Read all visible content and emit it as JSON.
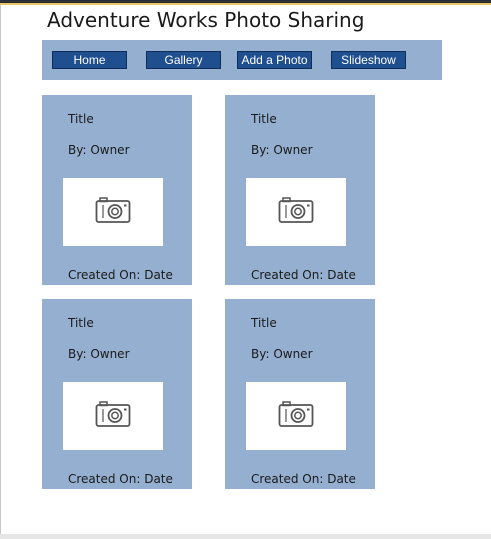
{
  "site": {
    "title": "Adventure Works Photo Sharing"
  },
  "nav": {
    "home": "Home",
    "gallery": "Gallery",
    "add_photo": "Add a Photo",
    "slideshow": "Slideshow"
  },
  "photos": [
    {
      "title": "Title",
      "owner": "By: Owner",
      "created": "Created On: Date",
      "icon": "camera-icon"
    },
    {
      "title": "Title",
      "owner": "By: Owner",
      "created": "Created On: Date",
      "icon": "camera-icon"
    },
    {
      "title": "Title",
      "owner": "By: Owner",
      "created": "Created On: Date",
      "icon": "camera-icon"
    },
    {
      "title": "Title",
      "owner": "By: Owner",
      "created": "Created On: Date",
      "icon": "camera-icon"
    }
  ],
  "colors": {
    "panel": "#95afd0",
    "button": "#1f4f8f",
    "thumbnail": "#ffffff"
  }
}
